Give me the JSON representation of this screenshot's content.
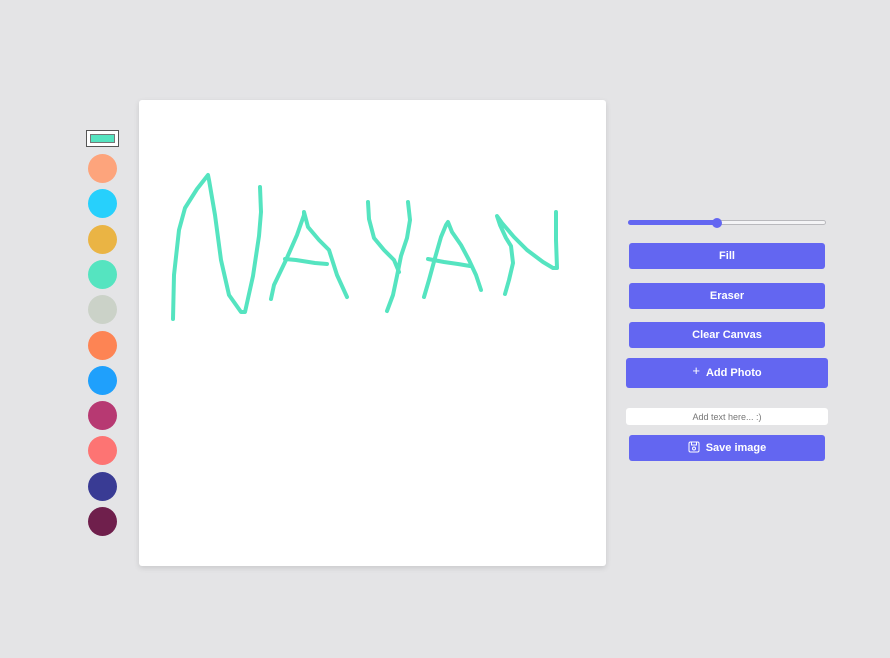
{
  "palette": {
    "selected_color": "#55e4c0",
    "colors": [
      "#fda47c",
      "#27d0fc",
      "#eab444",
      "#55e4c0",
      "#cbd2c8",
      "#fd8454",
      "#1fa0fc",
      "#b73972",
      "#fd7473",
      "#393b94",
      "#6f1f4c"
    ]
  },
  "canvas": {
    "stroke_color": "#55e4c0",
    "drawing_icon": "handwritten-scribble"
  },
  "controls": {
    "brush_size_level": 0.45,
    "accent_color": "#6366f1",
    "fill_label": "Fill",
    "eraser_label": "Eraser",
    "clear_label": "Clear Canvas",
    "add_photo_label": "Add Photo",
    "add_photo_icon": "plus-icon",
    "text_placeholder": "Add text here... :)",
    "save_label": "Save image",
    "save_icon": "floppy-disk-icon"
  }
}
